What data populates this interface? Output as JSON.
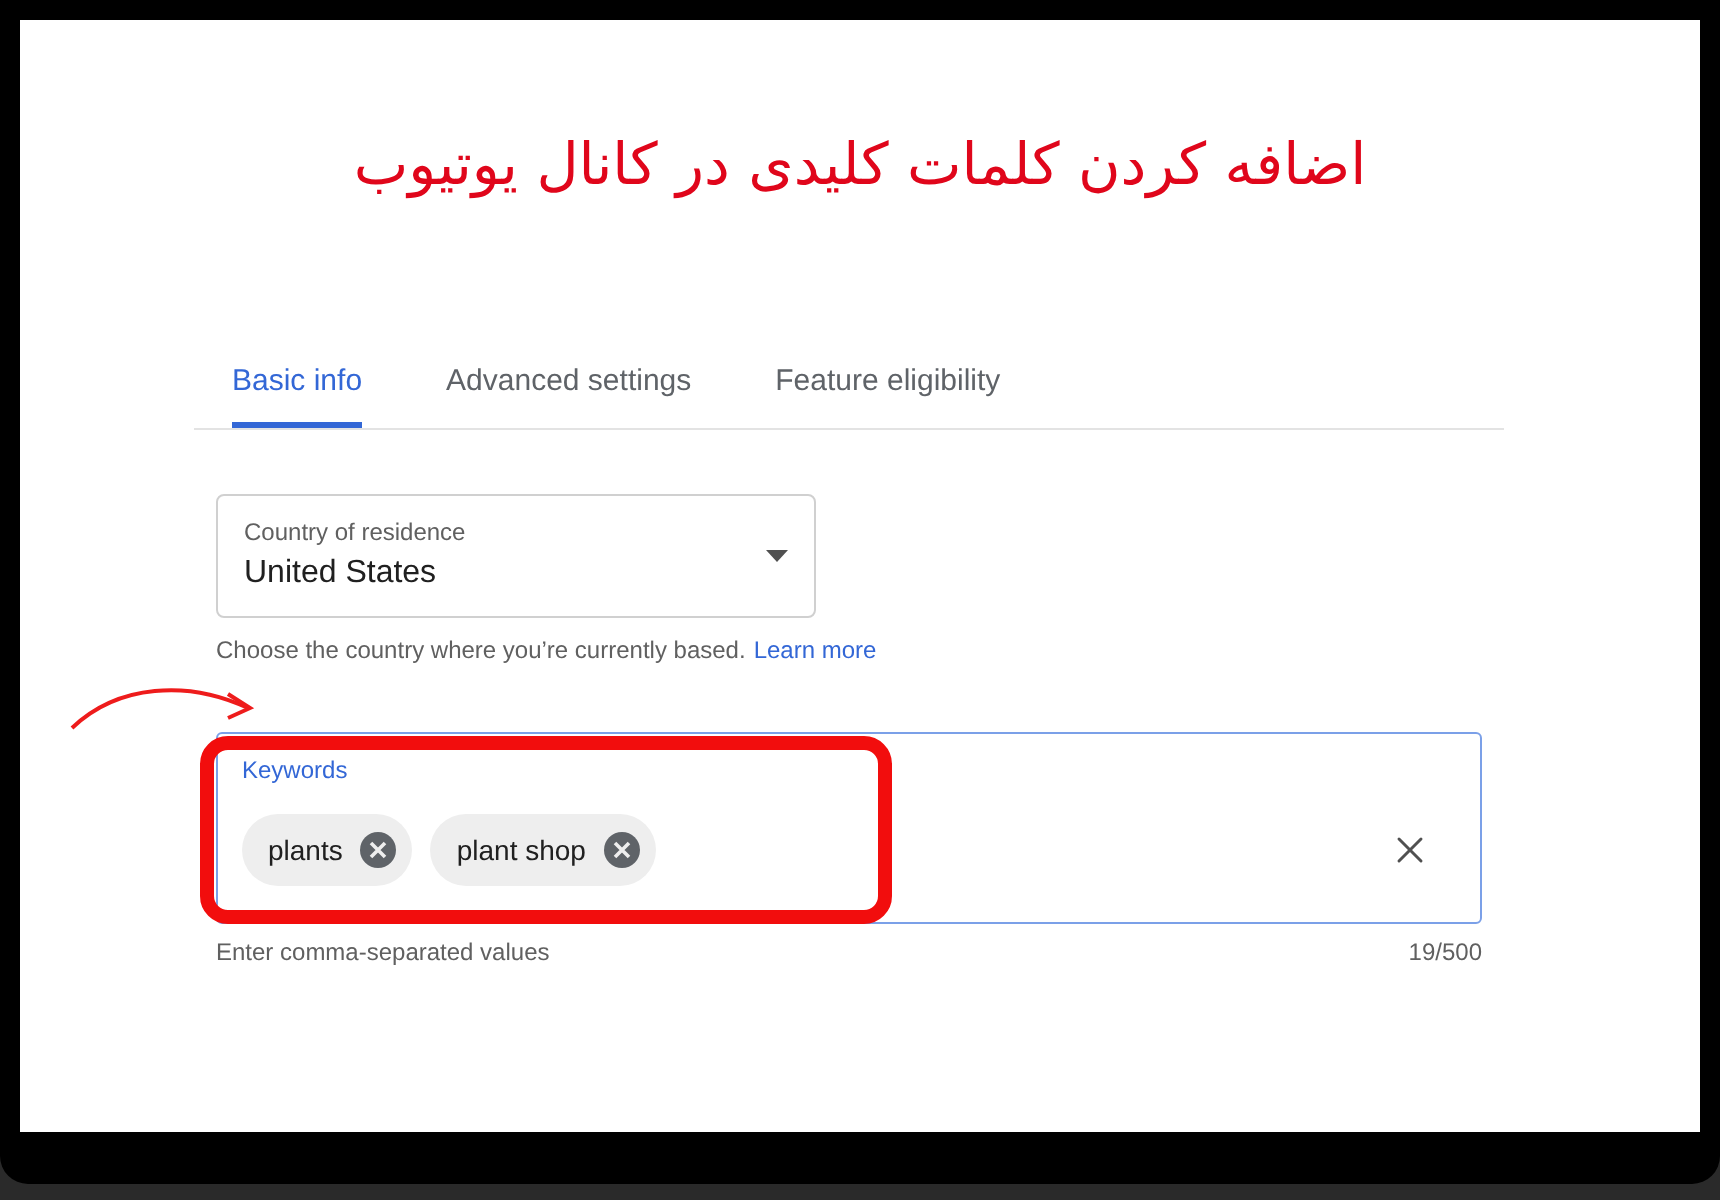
{
  "title": "اضافه کردن کلمات کلیدی در کانال یوتیوب",
  "tabs": [
    {
      "label": "Basic info",
      "selected": true
    },
    {
      "label": "Advanced settings",
      "selected": false
    },
    {
      "label": "Feature eligibility",
      "selected": false
    }
  ],
  "country": {
    "label": "Country of residence",
    "value": "United States",
    "helper": "Choose the country where you’re currently based.",
    "link": "Learn more"
  },
  "keywords": {
    "label": "Keywords",
    "chips": [
      "plants",
      "plant shop"
    ],
    "helper": "Enter comma-separated values",
    "counter": "19/500"
  }
}
